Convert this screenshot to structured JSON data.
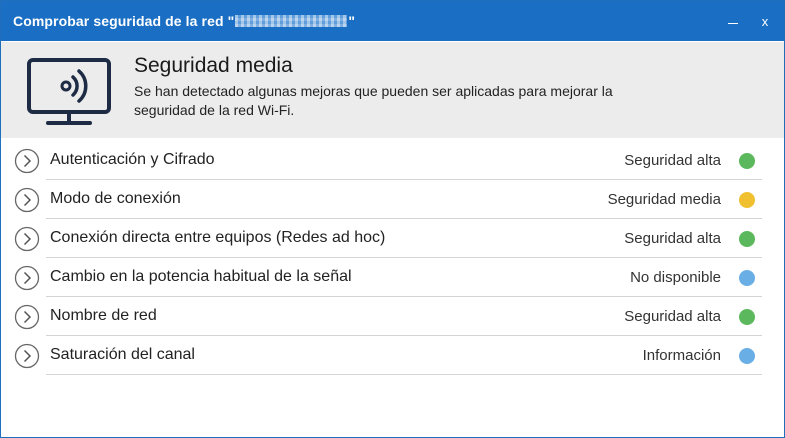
{
  "window": {
    "title_prefix": "Comprobar seguridad de la red \"",
    "title_suffix": "\"",
    "minimize_icon": "minimize-icon",
    "close_label": "x"
  },
  "header": {
    "title": "Seguridad media",
    "description": "Se han detectado algunas mejoras que pueden ser aplicadas para mejorar la seguridad de la red Wi-Fi.",
    "icon": "monitor-wifi-icon"
  },
  "checks": [
    {
      "label": "Autenticación y Cifrado",
      "status": "Seguridad alta",
      "color": "#5cb85c"
    },
    {
      "label": "Modo de conexión",
      "status": "Seguridad media",
      "color": "#f0c030"
    },
    {
      "label": "Conexión directa entre equipos (Redes ad hoc)",
      "status": "Seguridad alta",
      "color": "#5cb85c"
    },
    {
      "label": "Cambio en la potencia habitual de la señal",
      "status": "No disponible",
      "color": "#6aaee6"
    },
    {
      "label": "Nombre de red",
      "status": "Seguridad alta",
      "color": "#5cb85c"
    },
    {
      "label": "Saturación del canal",
      "status": "Información",
      "color": "#6aaee6"
    }
  ],
  "colors": {
    "titlebar": "#1a6fc4",
    "header_bg": "#ececec",
    "icon_navy": "#1d2b45"
  }
}
